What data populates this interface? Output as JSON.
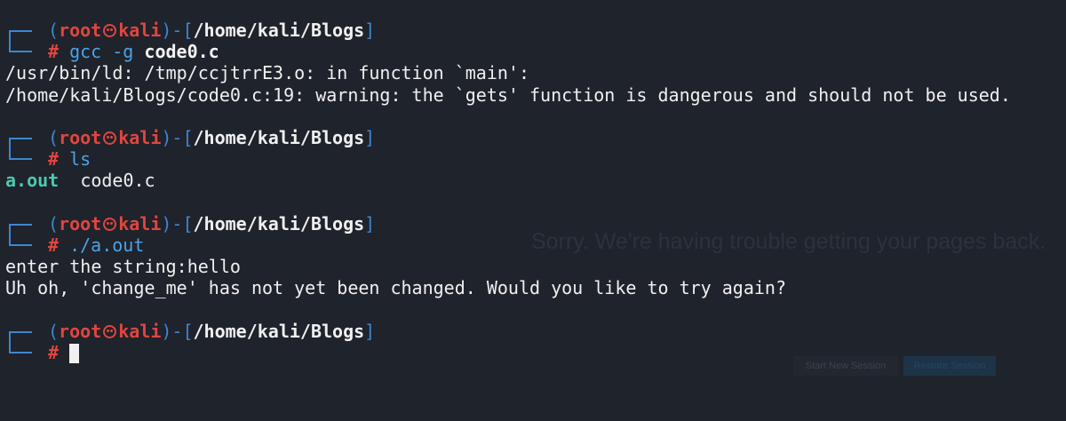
{
  "prompt": {
    "user": "root",
    "host": "kali",
    "cwd": "/home/kali/Blogs",
    "symbol": "#"
  },
  "session": [
    {
      "command": "gcc",
      "args": "-g",
      "bold_arg": "code0.c",
      "output": [
        "/usr/bin/ld: /tmp/ccjtrrE3.o: in function `main':",
        "/home/kali/Blogs/code0.c:19: warning: the `gets' function is dangerous and should not be used."
      ]
    },
    {
      "command": "ls",
      "files": [
        "a.out",
        "code0.c"
      ]
    },
    {
      "command": "./a.out",
      "output": [
        "enter the string:hello",
        "Uh oh, 'change_me' has not yet been changed. Would you like to try again?"
      ]
    }
  ],
  "background_ghost": {
    "title": "Sorry. We're having trouble getting your pages back.",
    "start_button": "Start New Session",
    "restore_button": "Restore Session"
  },
  "colors": {
    "background": "#1f232b",
    "prompt_bracket": "#3d86d1",
    "prompt_user": "#e0463f",
    "command": "#4aa3e8",
    "executable": "#4cc9b0",
    "text": "#f0f0f0"
  },
  "icons": {
    "user_host_separator": "kali-skull-icon",
    "cursor": "block-cursor"
  }
}
